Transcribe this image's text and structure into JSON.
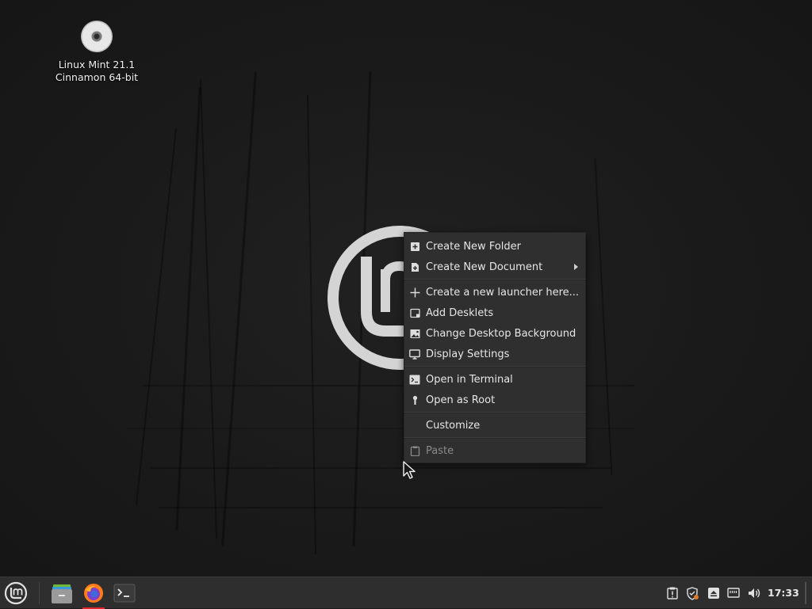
{
  "desktop": {
    "icon_label_line1": "Linux Mint 21.1",
    "icon_label_line2": "Cinnamon 64-bit",
    "icon": "optical-disc-icon"
  },
  "context_menu": {
    "items": [
      {
        "label": "Create New Folder",
        "icon": "new-folder-icon",
        "enabled": true
      },
      {
        "label": "Create New Document",
        "icon": "new-document-icon",
        "enabled": true,
        "submenu": true
      },
      {
        "label": "Create a new launcher here...",
        "icon": "plus-icon",
        "enabled": true
      },
      {
        "label": "Add Desklets",
        "icon": "desklet-icon",
        "enabled": true
      },
      {
        "label": "Change Desktop Background",
        "icon": "image-icon",
        "enabled": true
      },
      {
        "label": "Display Settings",
        "icon": "monitor-icon",
        "enabled": true
      },
      {
        "label": "Open in Terminal",
        "icon": "terminal-icon",
        "enabled": true
      },
      {
        "label": "Open as Root",
        "icon": "key-icon",
        "enabled": true
      },
      {
        "label": "Customize",
        "icon": "",
        "enabled": true
      },
      {
        "label": "Paste",
        "icon": "clipboard-icon",
        "enabled": false
      }
    ]
  },
  "taskbar": {
    "launchers": [
      {
        "name": "files",
        "icon": "file-manager-icon",
        "running": false
      },
      {
        "name": "firefox",
        "icon": "firefox-icon",
        "running": true
      },
      {
        "name": "terminal",
        "icon": "terminal-icon",
        "running": false
      }
    ],
    "tray": [
      "update-manager-icon",
      "shield-icon",
      "removable-drive-icon",
      "network-icon",
      "volume-icon"
    ],
    "clock": "17:33"
  },
  "colors": {
    "accent_running": "#e0262a",
    "menu_bg": "#2f2f2f",
    "panel_bg": "#2e2e2e"
  }
}
